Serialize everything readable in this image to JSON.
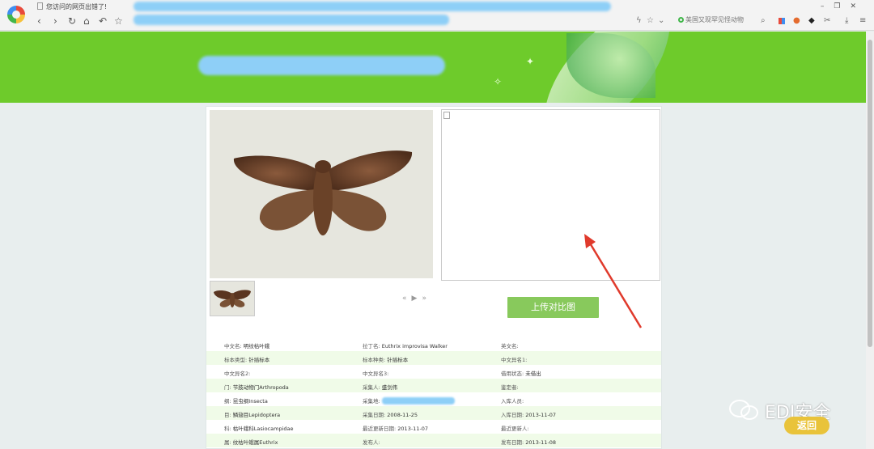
{
  "browser": {
    "tab_title": "您访问的网页出错了!",
    "nav_icons": [
      "back-icon",
      "forward-icon",
      "reload-icon",
      "home-icon",
      "undo-icon",
      "star-icon"
    ],
    "search_placeholder": "美国又现罕见怪动物",
    "window_controls": [
      "minimize-icon",
      "restore-icon",
      "close-icon"
    ]
  },
  "compare": {
    "upload_label": "上传对比图"
  },
  "pager": {
    "prev": "«",
    "play": "▶",
    "next": "»"
  },
  "info": {
    "rows": [
      [
        {
          "label": "中文名:",
          "value": "明纹枯叶蛾"
        },
        {
          "label": "拉丁名:",
          "value": "Euthrix improvisa Walker"
        },
        {
          "label": "英文名:",
          "value": ""
        }
      ],
      [
        {
          "label": "标本类型:",
          "value": "针插标本"
        },
        {
          "label": "标本种类:",
          "value": "针插标本"
        },
        {
          "label": "中文异名1:",
          "value": ""
        }
      ],
      [
        {
          "label": "中文异名2:",
          "value": ""
        },
        {
          "label": "中文异名3:",
          "value": ""
        },
        {
          "label": "借用状态:",
          "value": "未借出"
        }
      ],
      [
        {
          "label": "门:",
          "value": "节肢动物门Arthropoda"
        },
        {
          "label": "采集人:",
          "value": "盛剑伟"
        },
        {
          "label": "鉴定者:",
          "value": ""
        }
      ],
      [
        {
          "label": "纲:",
          "value": "昆虫纲Insecta"
        },
        {
          "label": "采集地:",
          "value": ""
        },
        {
          "label": "入库人员:",
          "value": ""
        }
      ],
      [
        {
          "label": "目:",
          "value": "鳞翅目Lepidoptera"
        },
        {
          "label": "采集日期:",
          "value": "2008-11-25"
        },
        {
          "label": "入库日期:",
          "value": "2013-11-07"
        }
      ],
      [
        {
          "label": "科:",
          "value": "枯叶蛾科Lasiocampidae"
        },
        {
          "label": "最近更新日期:",
          "value": "2013-11-07"
        },
        {
          "label": "最近更新人:",
          "value": ""
        }
      ],
      [
        {
          "label": "属:",
          "value": "纹枯叶蛾属Euthrix"
        },
        {
          "label": "发布人:",
          "value": ""
        },
        {
          "label": "发布日期:",
          "value": "2013-11-08"
        }
      ]
    ]
  },
  "watermark": {
    "text": "EDI安全",
    "back_label": "返回"
  },
  "colors": {
    "banner_green": "#6ecb2b",
    "button_green": "#88c95c",
    "row_alt": "#f0fbe8",
    "redaction_blue": "#8ecff7",
    "arrow_red": "#e03a2c",
    "back_yellow": "#e9c33a"
  }
}
